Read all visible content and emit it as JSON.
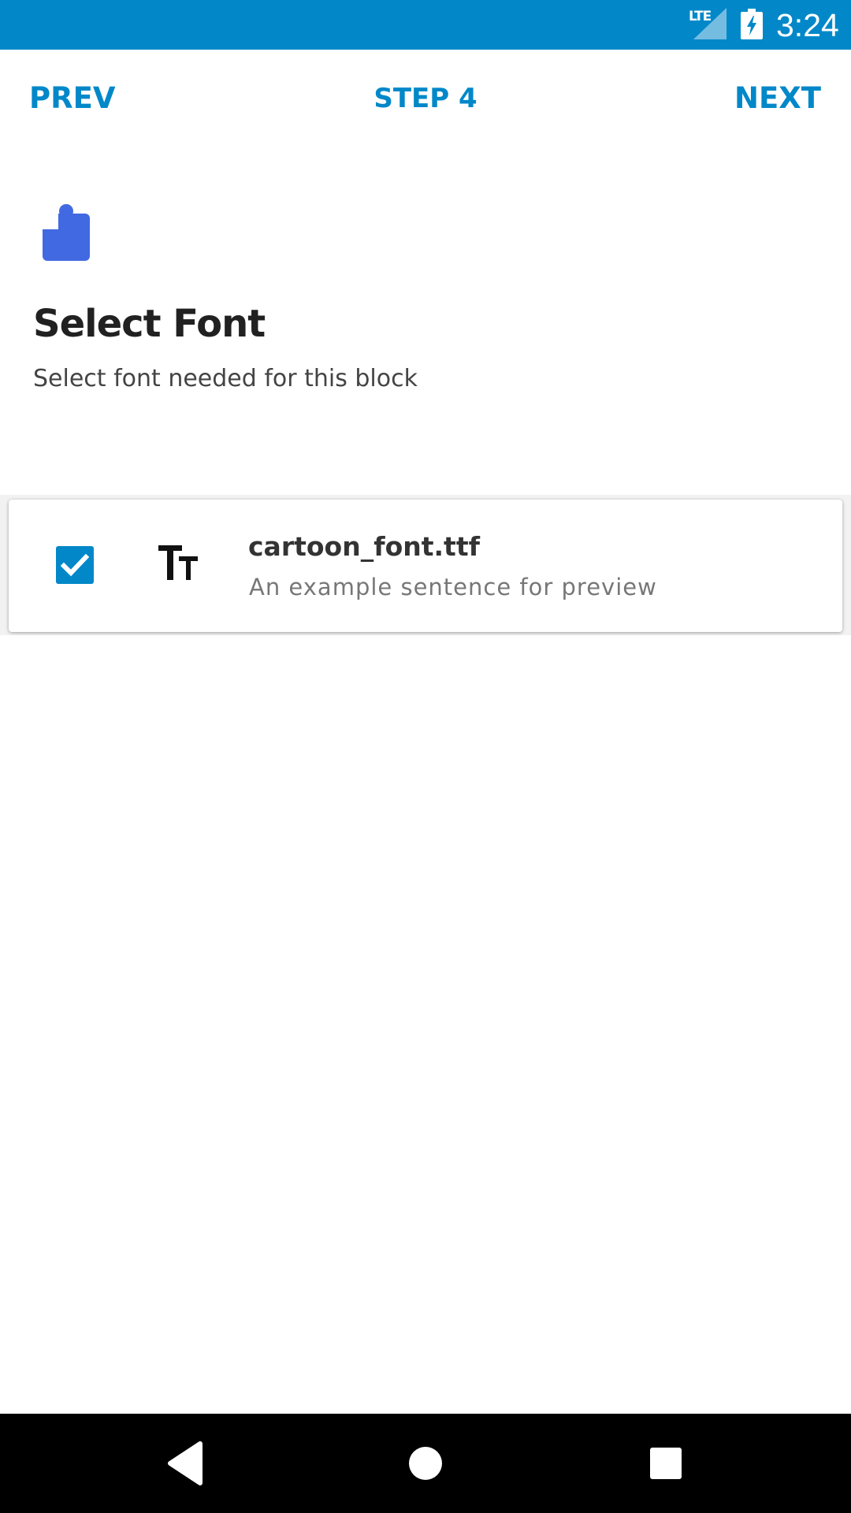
{
  "status_bar": {
    "network": "LTE",
    "time": "3:24",
    "background_color": "#0288C9"
  },
  "nav": {
    "prev_label": "PREV",
    "step_label": "STEP 4",
    "next_label": "NEXT",
    "accent_color": "#0288C9"
  },
  "header": {
    "icon": "puzzle-piece-icon",
    "icon_color": "#4169E1",
    "title": "Select Font",
    "subtitle": "Select font needed for this block"
  },
  "font_list": [
    {
      "checked": true,
      "icon": "font-size-icon",
      "name": "cartoon_font.ttf",
      "preview": "An example sentence for preview"
    }
  ],
  "system_nav": {
    "back": "back-triangle-icon",
    "home": "home-circle-icon",
    "recents": "recents-square-icon"
  }
}
